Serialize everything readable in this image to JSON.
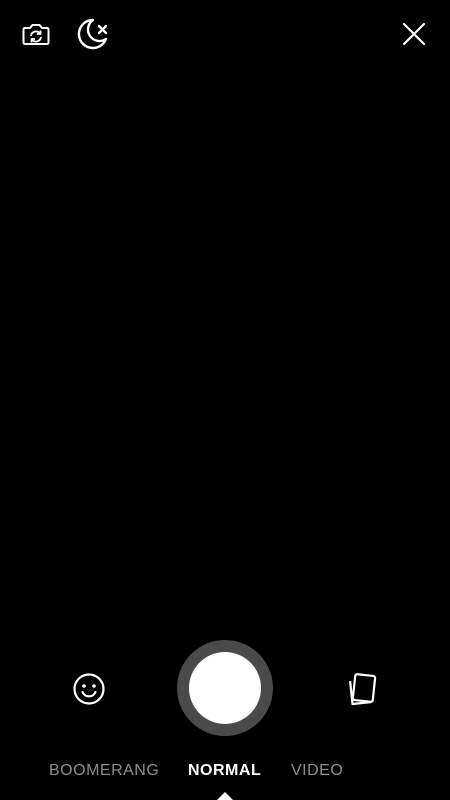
{
  "top_bar": {
    "flip_icon": "camera-flip-icon",
    "night_icon": "night-mode-off-icon",
    "close_icon": "close-icon"
  },
  "bottom_bar": {
    "face_icon": "face-effects-icon",
    "gallery_icon": "gallery-icon"
  },
  "modes": [
    {
      "label": "BOOMERANG",
      "active": false
    },
    {
      "label": "NORMAL",
      "active": true
    },
    {
      "label": "VIDEO",
      "active": false
    }
  ],
  "colors": {
    "background": "#000000",
    "active_mode": "#ffffff",
    "inactive_mode": "#8e8e8e",
    "shutter_ring": "#4a4a4a",
    "shutter_center": "#ffffff"
  }
}
